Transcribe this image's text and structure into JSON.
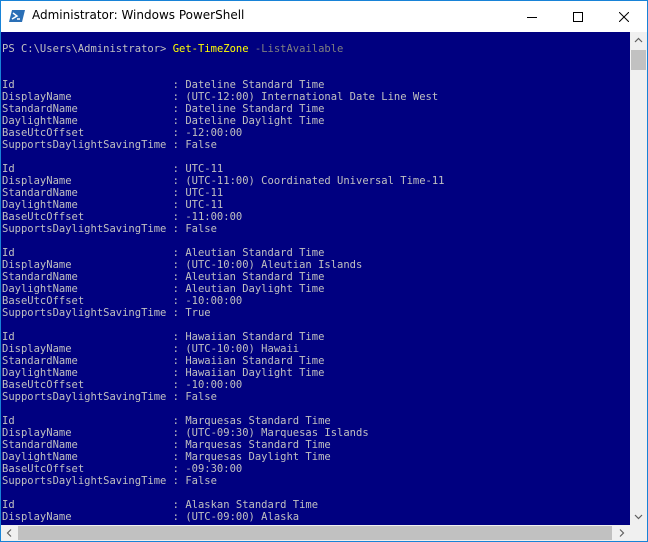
{
  "window": {
    "title": "Administrator: Windows PowerShell",
    "accent_color": "#1883d7",
    "console_background": "#000080",
    "caption_buttons": [
      "minimize-icon",
      "maximize-icon",
      "close-icon"
    ]
  },
  "console": {
    "prompt": "PS C:\\Users\\Administrator> ",
    "command": "Get-TimeZone",
    "parameter": " -ListAvailable",
    "lines": [
      "Id                         : Dateline Standard Time",
      "DisplayName                : (UTC-12:00) International Date Line West",
      "StandardName               : Dateline Standard Time",
      "DaylightName               : Dateline Daylight Time",
      "BaseUtcOffset              : -12:00:00",
      "SupportsDaylightSavingTime : False",
      "",
      "Id                         : UTC-11",
      "DisplayName                : (UTC-11:00) Coordinated Universal Time-11",
      "StandardName               : UTC-11",
      "DaylightName               : UTC-11",
      "BaseUtcOffset              : -11:00:00",
      "SupportsDaylightSavingTime : False",
      "",
      "Id                         : Aleutian Standard Time",
      "DisplayName                : (UTC-10:00) Aleutian Islands",
      "StandardName               : Aleutian Standard Time",
      "DaylightName               : Aleutian Daylight Time",
      "BaseUtcOffset              : -10:00:00",
      "SupportsDaylightSavingTime : True",
      "",
      "Id                         : Hawaiian Standard Time",
      "DisplayName                : (UTC-10:00) Hawaii",
      "StandardName               : Hawaiian Standard Time",
      "DaylightName               : Hawaiian Daylight Time",
      "BaseUtcOffset              : -10:00:00",
      "SupportsDaylightSavingTime : False",
      "",
      "Id                         : Marquesas Standard Time",
      "DisplayName                : (UTC-09:30) Marquesas Islands",
      "StandardName               : Marquesas Standard Time",
      "DaylightName               : Marquesas Daylight Time",
      "BaseUtcOffset              : -09:30:00",
      "SupportsDaylightSavingTime : False",
      "",
      "Id                         : Alaskan Standard Time",
      "DisplayName                : (UTC-09:00) Alaska"
    ]
  }
}
